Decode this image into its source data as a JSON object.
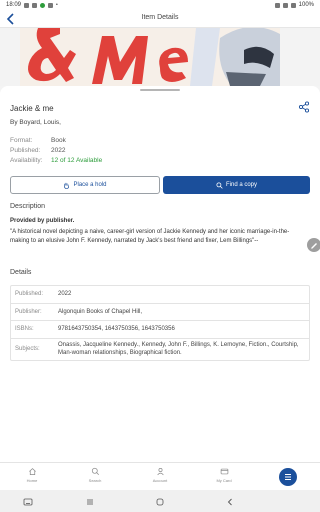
{
  "status_bar": {
    "time": "18:09",
    "battery": "100%"
  },
  "header": {
    "title": "Item Details"
  },
  "item": {
    "title": "Jackie & me",
    "author": "By Boyard, Louis,",
    "format_label": "Format:",
    "format": "Book",
    "published_label": "Published:",
    "published": "2022",
    "availability_label": "Availability:",
    "availability": "12 of 12 Available"
  },
  "actions": {
    "hold": "Place a hold",
    "find": "Find a copy"
  },
  "description": {
    "heading": "Description",
    "provided": "Provided by publisher.",
    "text": "\"A historical novel depicting a naive, career-girl version of Jackie Kennedy and her iconic marriage-in-the-making to an elusive John F. Kennedy, narrated by Jack's best friend and fixer, Lem Billings\"--"
  },
  "details": {
    "heading": "Details",
    "rows": [
      {
        "label": "Published:",
        "value": "2022"
      },
      {
        "label": "Publisher:",
        "value": "Algonquin Books of Chapel Hill,"
      },
      {
        "label": "ISBNs:",
        "value": "9781643750354, 1643750356, 1643750356"
      },
      {
        "label": "Subjects:",
        "value": "Onassis, Jacqueline Kennedy., Kennedy, John F., Billings, K. Lemoyne, Fiction., Courtship, Man-woman relationships, Biographical fiction."
      }
    ]
  },
  "bottom_nav": {
    "home": "Home",
    "search": "Search",
    "account": "Account",
    "card": "My Card"
  },
  "colors": {
    "primary": "#1b4f9b",
    "available": "#2e9d3c"
  }
}
